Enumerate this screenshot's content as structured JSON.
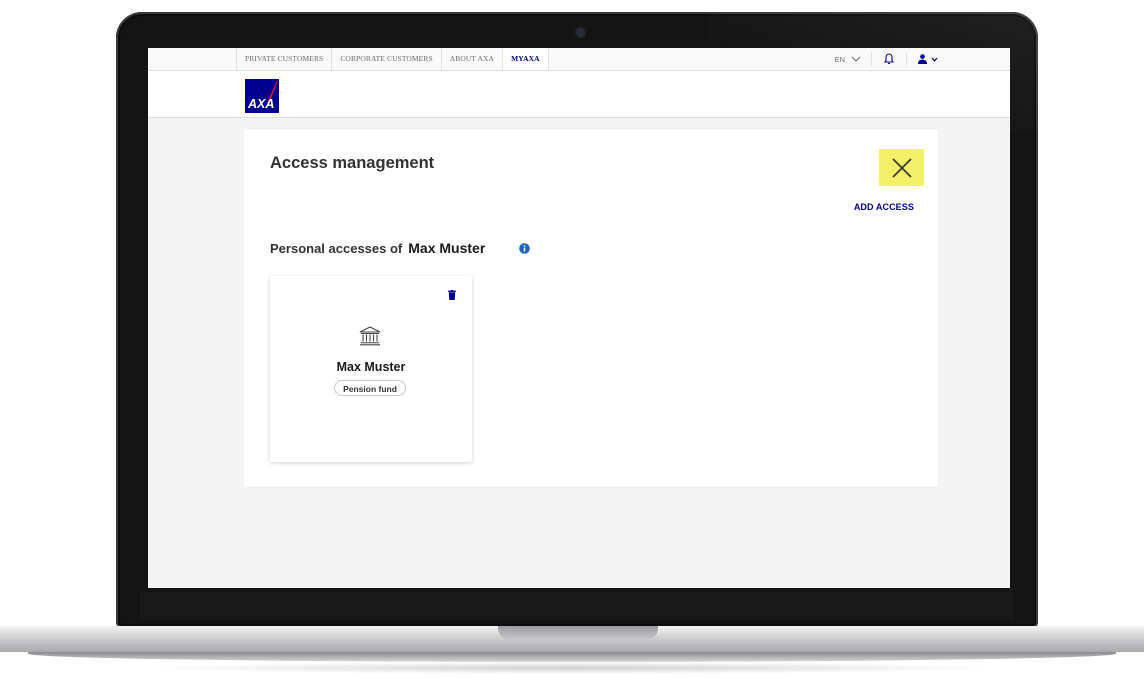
{
  "nav": {
    "tabs": [
      {
        "label": "PRIVATE CUSTOMERS"
      },
      {
        "label": "CORPORATE CUSTOMERS"
      },
      {
        "label": "ABOUT AXA"
      },
      {
        "label": "MYAXA",
        "active": true
      }
    ],
    "language": "EN",
    "icons": {
      "bell": "bell-icon",
      "user": "user-icon",
      "chevron": "chevron-down-icon"
    }
  },
  "brand": {
    "logo_text": "AXA",
    "primary_color": "#00008f",
    "accent_color": "#ff1721"
  },
  "page": {
    "title": "Access management",
    "close_button_color": "#f4f067",
    "add_access_label": "ADD ACCESS",
    "section_title": "Personal accesses of",
    "section_name": "Max Muster"
  },
  "access_cards": [
    {
      "holder": "Max Muster",
      "type": "Pension fund",
      "icon": "bank-icon",
      "action_icon": "trash-icon"
    }
  ]
}
